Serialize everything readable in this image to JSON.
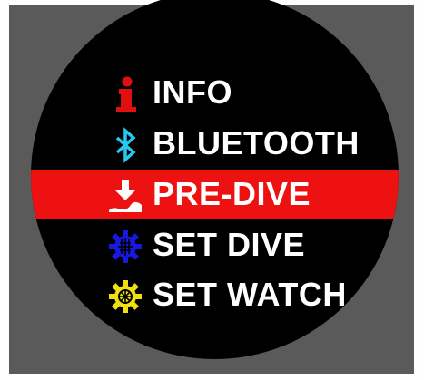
{
  "menu": {
    "items": [
      {
        "label": "INFO",
        "icon": "info-icon",
        "color": "#e01010",
        "selected": false
      },
      {
        "label": "BLUETOOTH",
        "icon": "bluetooth-icon",
        "color": "#28c8f0",
        "selected": false
      },
      {
        "label": "PRE-DIVE",
        "icon": "pre-dive-icon",
        "color": "#ffffff",
        "selected": true
      },
      {
        "label": "SET DIVE",
        "icon": "set-dive-gear-icon",
        "color": "#1818e0",
        "selected": false
      },
      {
        "label": "SET WATCH",
        "icon": "set-watch-gear-icon",
        "color": "#f0e010",
        "selected": false
      }
    ]
  },
  "colors": {
    "background": "#000000",
    "highlight": "#ee1111",
    "text": "#ffffff"
  }
}
